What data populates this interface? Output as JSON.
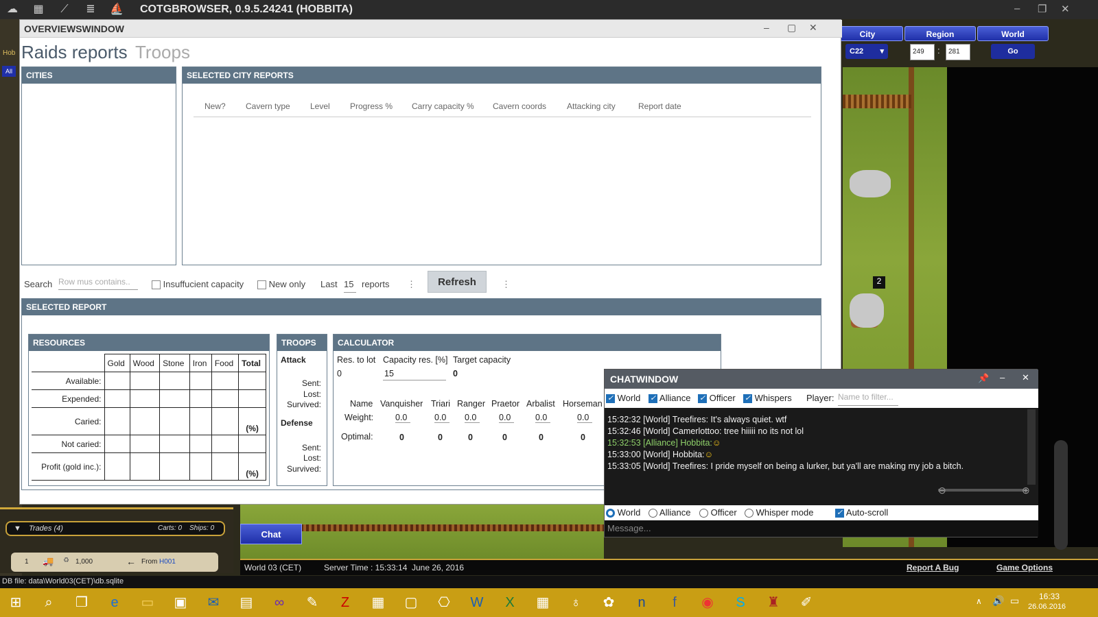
{
  "app": {
    "title": "COTGBROWSER, 0.9.5.24241 (HOBBITA)"
  },
  "nav": {
    "city": "City",
    "region": "Region",
    "world": "World",
    "city_select": "C22",
    "coord_x": "249",
    "coord_y": "281",
    "go": "Go"
  },
  "overview": {
    "title": "OVERVIEWSWINDOW",
    "tabs": [
      "Raids reports",
      "Troops"
    ],
    "cities_head": "CITIES",
    "reports_head": "SELECTED CITY REPORTS",
    "report_cols": [
      "New?",
      "Cavern type",
      "Level",
      "Progress %",
      "Carry capacity %",
      "Cavern coords",
      "Attacking city",
      "Report date"
    ],
    "search_label": "Search",
    "search_placeholder": "Row mus contains..",
    "insufficient": "Insuffucient capacity",
    "new_only": "New only",
    "last_label": "Last",
    "last_value": "15",
    "reports_label": "reports",
    "refresh": "Refresh",
    "selected_report_head": "SELECTED REPORT",
    "resources": {
      "head": "RESOURCES",
      "cols": [
        "Gold",
        "Wood",
        "Stone",
        "Iron",
        "Food",
        "Total"
      ],
      "rows": [
        "Available:",
        "Expended:",
        "Caried:",
        "Not caried:",
        "Profit (gold inc.):"
      ],
      "pct": "(%)"
    },
    "troops": {
      "head": "TROOPS",
      "attack": "Attack",
      "sent": "Sent:",
      "lost": "Lost:",
      "survived": "Survived:",
      "defense": "Defense"
    },
    "calculator": {
      "head": "CALCULATOR",
      "res_to_lot": "Res. to lot",
      "res_val": "0",
      "cap_res": "Capacity res. [%]",
      "cap_val": "15",
      "target": "Target capacity",
      "target_val": "0",
      "name_label": "Name",
      "weight_label": "Weight:",
      "optimal_label": "Optimal:",
      "units": [
        "Vanquisher",
        "Triari",
        "Ranger",
        "Praetor",
        "Arbalist",
        "Horseman"
      ],
      "weights": [
        "0.0",
        "0.0",
        "0.0",
        "0.0",
        "0.0",
        "0.0"
      ],
      "optimals": [
        "0",
        "0",
        "0",
        "0",
        "0",
        "0"
      ]
    }
  },
  "chat": {
    "title": "CHATWINDOW",
    "filters": [
      "World",
      "Alliance",
      "Officer",
      "Whispers"
    ],
    "player_label": "Player:",
    "player_placeholder": "Name to filter...",
    "messages": [
      {
        "text": "15:32:32 [World] Treefires: It's always quiet. wtf",
        "color": "#f2f2f2"
      },
      {
        "text": "15:32:46 [World] Camerlottoo: tree hiiiii no its not lol",
        "color": "#f2f2f2"
      },
      {
        "text": "15:32:53 [Alliance] Hobbita:",
        "color": "#8fd16a"
      },
      {
        "text": "15:33:00 [World] Hobbita:",
        "color": "#f2f2f2"
      },
      {
        "text": "15:33:05 [World] Treefires: I pride myself on being a lurker, but ya'll are making my job a bitch.",
        "color": "#f2f2f2"
      }
    ],
    "modes": [
      "World",
      "Alliance",
      "Officer",
      "Whisper mode"
    ],
    "autoscroll": "Auto-scroll",
    "message_placeholder": "Message..."
  },
  "game": {
    "trades": "Trades (4)",
    "carts": "Carts: 0",
    "ships": "Ships: 0",
    "trade_num": "1",
    "trade_amount": "1,000",
    "trade_from": "From",
    "trade_city": "H001",
    "chat_button": "Chat",
    "world": "World 03 (CET)",
    "server_time": "Server Time : 15:33:14",
    "date": "June 26, 2016",
    "report_bug": "Report A Bug",
    "game_options": "Game Options",
    "db_file": "DB file: data\\World03(CET)\\db.sqlite",
    "left_label": "Hob",
    "all_label": "All",
    "badge_a": "2",
    "badge_b": "2"
  },
  "taskbar": {
    "time": "16:33",
    "date": "26.06.2016"
  }
}
